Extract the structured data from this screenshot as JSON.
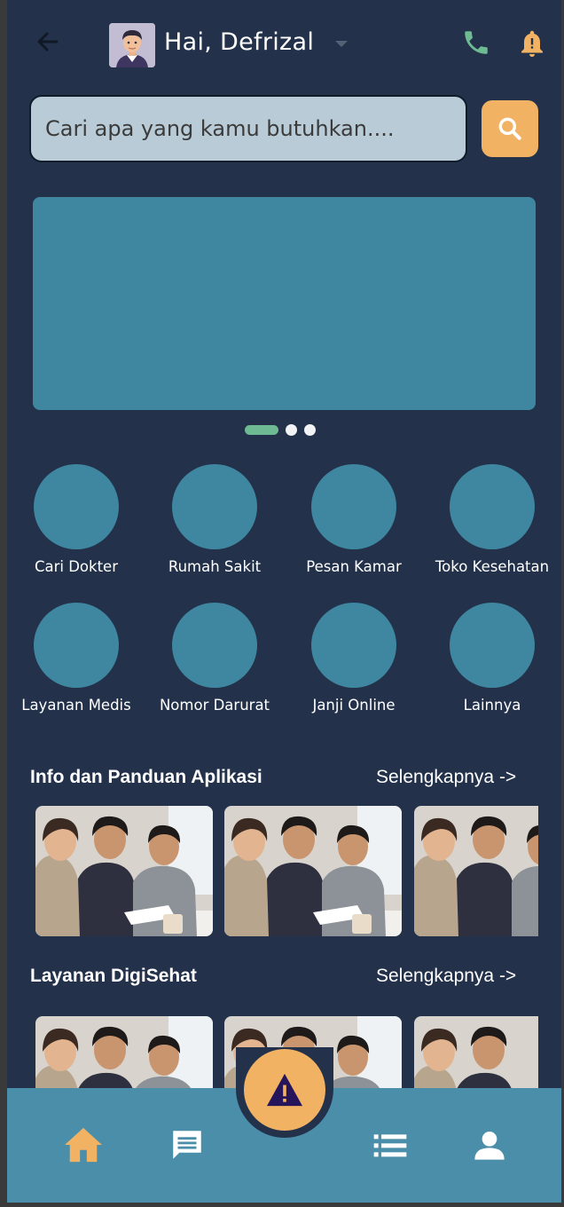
{
  "header": {
    "greeting": "Hai, Defrizal",
    "icons": [
      "back-arrow-icon",
      "avatar",
      "dropdown-arrow-icon",
      "phone-icon",
      "bell-icon"
    ]
  },
  "search": {
    "placeholder": "Cari apa yang kamu butuhkan....",
    "button_icon": "search-icon"
  },
  "banner": {
    "color": "#3f86a0",
    "dots": {
      "count": 3,
      "active_index": 0
    }
  },
  "menu": {
    "items": [
      {
        "label": "Cari Dokter"
      },
      {
        "label": "Rumah Sakit"
      },
      {
        "label": "Pesan Kamar"
      },
      {
        "label": "Toko Kesehatan"
      },
      {
        "label": "Layanan Medis"
      },
      {
        "label": "Nomor Darurat"
      },
      {
        "label": "Janji Online"
      },
      {
        "label": "Lainnya"
      }
    ]
  },
  "sections": [
    {
      "title": "Info dan Panduan Aplikasi",
      "see_more": "Selengkapnya ->"
    },
    {
      "title": "Layanan DigiSehat",
      "see_more": "Selengkapnya ->"
    }
  ],
  "bottom_nav": {
    "items": [
      "home-icon",
      "chat-icon",
      "alert-icon",
      "list-icon",
      "person-icon"
    ],
    "active": "home-icon"
  },
  "colors": {
    "background": "#23324a",
    "accent": "#f1b264",
    "teal": "#3f86a0",
    "nav": "#4a8eaa",
    "green": "#6dba93"
  }
}
